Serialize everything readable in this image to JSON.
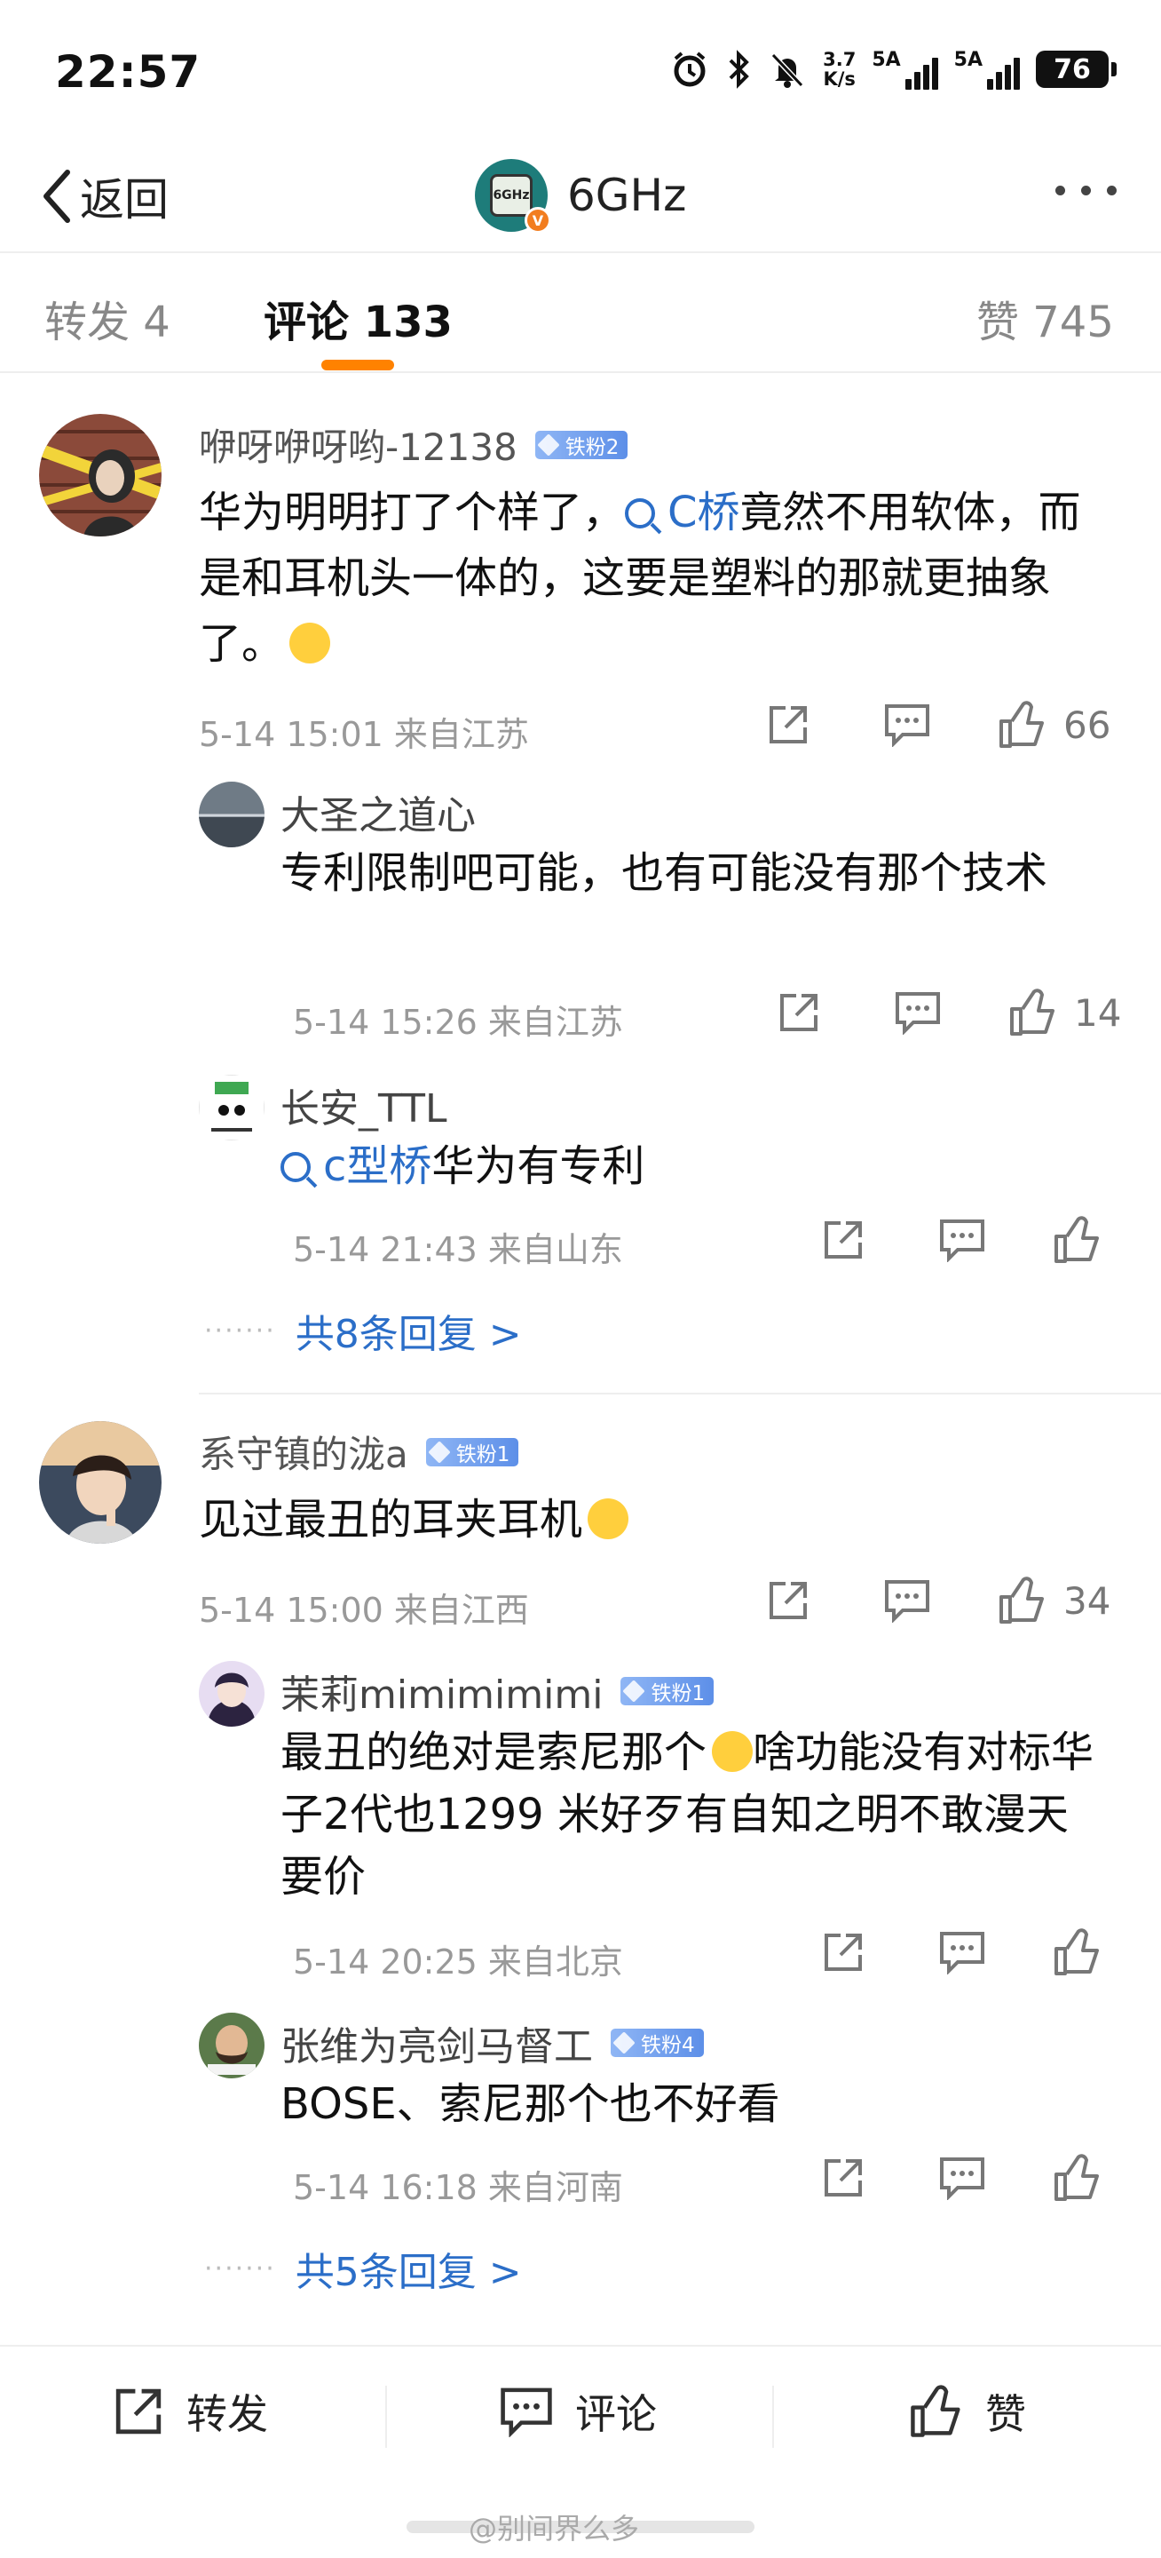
{
  "status": {
    "time": "22:57",
    "netspeed_top": "3.7",
    "netspeed_bottom": "K/s",
    "sim1": "5A",
    "sim2": "5A",
    "battery": "76"
  },
  "header": {
    "back_label": "返回",
    "title": "6GHz",
    "avatar_text": "6GHz"
  },
  "tabs": {
    "repost": "转发 4",
    "comments": "评论 133",
    "likes": "赞 745"
  },
  "comments": [
    {
      "user": "咿呀咿呀哟-12138",
      "badge": "铁粉2",
      "text_before": "华为明明打了个样了，",
      "link": "C桥",
      "text_after": "竟然不用软体，而是和耳机头一体的，这要是塑料的那就更抽象了。",
      "meta": "5-14 15:01 来自江苏",
      "likes": "66",
      "replies": [
        {
          "user": "大圣之道心",
          "badge": "",
          "text": "专利限制吧可能，也有可能没有那个技术",
          "meta": "5-14 15:26 来自江苏",
          "likes": "14"
        },
        {
          "user": "长安_TTL",
          "badge": "",
          "link": "c型桥",
          "text": "华为有专利",
          "meta": "5-14 21:43 来自山东",
          "likes": ""
        }
      ],
      "more_replies": "共8条回复 >"
    },
    {
      "user": "系守镇的泷a",
      "badge": "铁粉1",
      "text": "见过最丑的耳夹耳机",
      "meta": "5-14 15:00 来自江西",
      "likes": "34",
      "replies": [
        {
          "user": "茉莉mimimimimi",
          "badge": "铁粉1",
          "text_before": "最丑的绝对是索尼那个",
          "text_after": "啥功能没有对标华子2代也1299 米好歹有自知之明不敢漫天要价",
          "meta": "5-14 20:25 来自北京",
          "likes": ""
        },
        {
          "user": "张维为亮剑马督工",
          "badge": "铁粉4",
          "text": "BOSE、索尼那个也不好看",
          "meta": "5-14 16:18 来自河南",
          "likes": ""
        }
      ],
      "more_replies": "共5条回复 >"
    }
  ],
  "bottombar": {
    "repost": "转发",
    "comment": "评论",
    "like": "赞"
  },
  "watermark": "@别间界么多"
}
